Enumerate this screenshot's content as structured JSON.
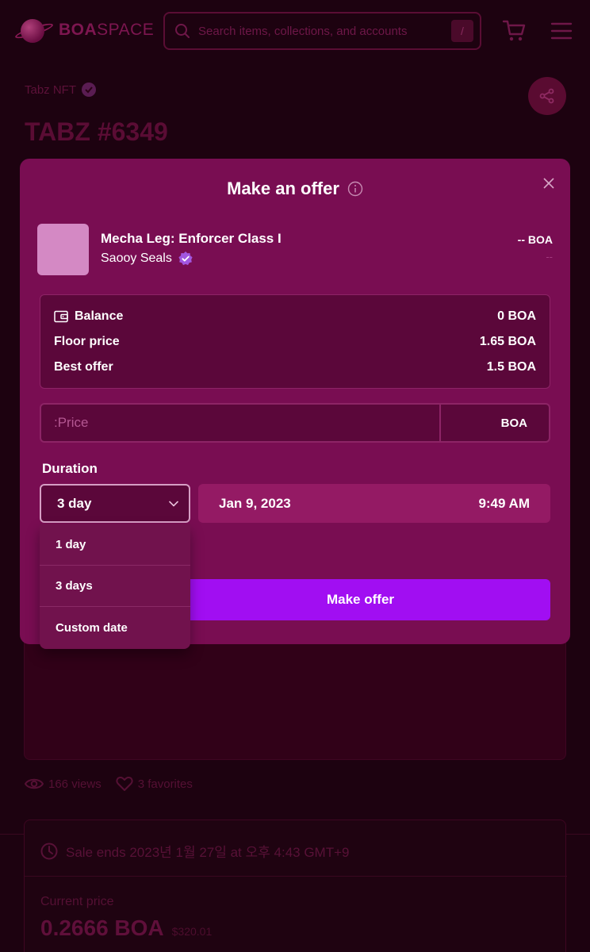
{
  "header": {
    "logo_bold": "BOA",
    "logo_thin": "SPACE",
    "search_placeholder": "Search items, collections, and accounts",
    "search_shortcut": "/"
  },
  "item": {
    "collection": "Tabz NFT",
    "title": "TABZ #6349"
  },
  "stats": {
    "views": "166 views",
    "favorites": "3 favorites"
  },
  "sale": {
    "ends": "Sale ends 2023년 1월 27일 at 오후 4:43 GMT+9",
    "current_price_label": "Current price",
    "current_price": "0.2666 BOA",
    "current_price_usd": "$320.01"
  },
  "modal": {
    "title": "Make an offer",
    "product_name": "Mecha Leg: Enforcer Class I",
    "product_collection": "Saooy Seals",
    "product_price": "-- BOA",
    "product_usd": "--",
    "balance_label": "Balance",
    "balance_value": "0 BOA",
    "floor_label": "Floor price",
    "floor_value": "1.65 BOA",
    "best_label": "Best offer",
    "best_value": "1.5 BOA",
    "price_placeholder": ":Price",
    "currency": "BOA",
    "duration_label": "Duration",
    "duration_selected": "3 day",
    "date": "Jan 9, 2023",
    "time": "9:49 AM",
    "submit_label": "Make offer",
    "options": [
      "1 day",
      "3 days",
      "Custom date"
    ]
  },
  "colors": {
    "accent": "#a10ef2",
    "modal_bg": "#790d52",
    "page_bg": "#1d0210"
  }
}
